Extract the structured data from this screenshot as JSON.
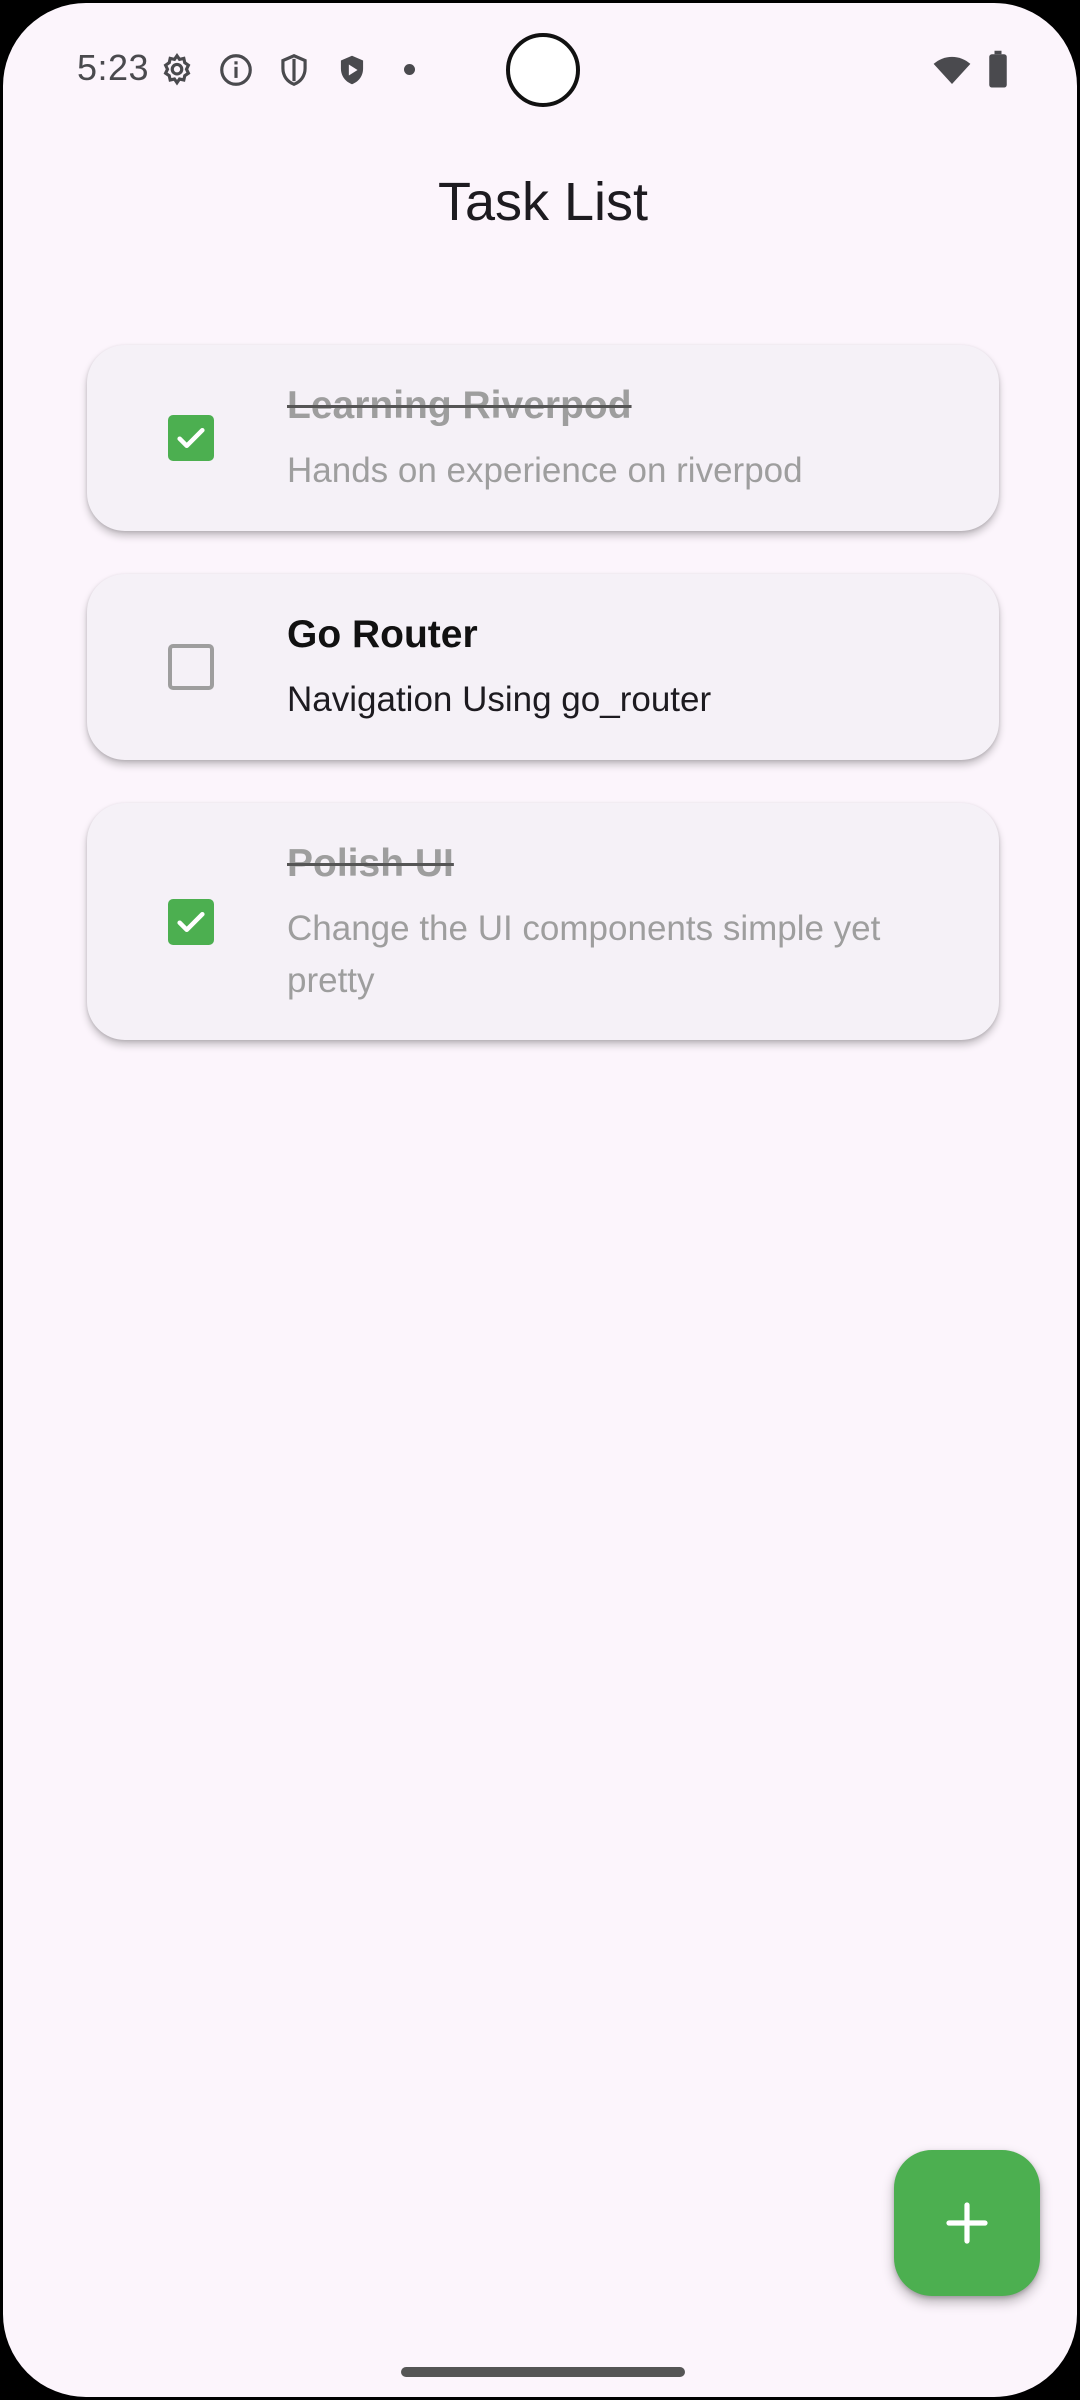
{
  "status_bar": {
    "time": "5:23",
    "icons": [
      "gear-icon",
      "info-icon",
      "shield-icon",
      "play-shield-icon",
      "notification-dot",
      "wifi-icon",
      "battery-icon"
    ]
  },
  "app_bar": {
    "title": "Task List"
  },
  "tasks": [
    {
      "title": "Learning Riverpod",
      "description": "Hands on experience on riverpod",
      "completed": true
    },
    {
      "title": "Go Router",
      "description": "Navigation Using go_router",
      "completed": false
    },
    {
      "title": "Polish UI",
      "description": "Change the UI components simple yet pretty",
      "completed": true
    }
  ],
  "fab": {
    "icon": "plus-icon"
  },
  "colors": {
    "accent": "#4caf50",
    "background": "#fcf5fc",
    "card": "#f5f1f7",
    "done_text": "#9e9e9e"
  }
}
